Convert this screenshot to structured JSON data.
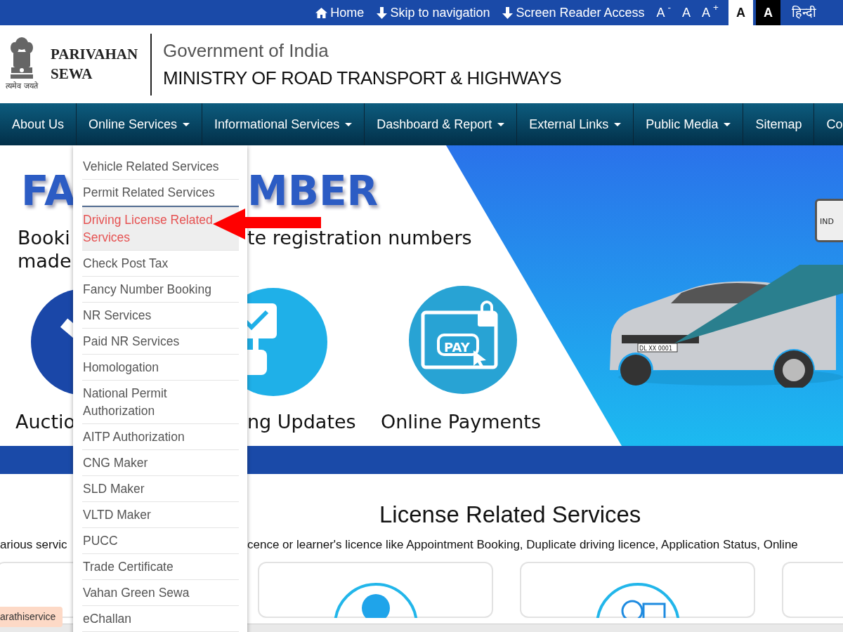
{
  "top_bar": {
    "links": [
      {
        "kind": "home",
        "label": "Home"
      },
      {
        "kind": "down",
        "label": "Skip to navigation"
      },
      {
        "kind": "down",
        "label": "Screen Reader Access"
      }
    ],
    "font_size_buttons": [
      "A$^{-}$",
      "A",
      "A$^{+}$"
    ],
    "contrast_buttons": [
      {
        "kind": "light",
        "label": "A"
      },
      {
        "kind": "dark",
        "label": "A"
      }
    ],
    "language": "हिन्दी"
  },
  "header": {
    "brand_lines": [
      "PARIVAHAN",
      "SEWA"
    ],
    "motto": "त्यमेव जयते",
    "org": "Government of India",
    "ministry": "MINISTRY OF ROAD TRANSPORT & HIGHWAYS"
  },
  "nav": [
    {
      "label": "About Us",
      "dropdown": false
    },
    {
      "label": "Online Services",
      "dropdown": true
    },
    {
      "label": "Informational Services",
      "dropdown": true
    },
    {
      "label": "Dashboard & Report",
      "dropdown": true
    },
    {
      "label": "External Links",
      "dropdown": true
    },
    {
      "label": "Public Media",
      "dropdown": true
    },
    {
      "label": "Sitemap",
      "dropdown": false
    },
    {
      "label": "Co",
      "dropdown": false
    }
  ],
  "menu": [
    {
      "label": "Vehicle Related Services",
      "selected": false
    },
    {
      "label": "Permit Related Services",
      "selected": false
    },
    {
      "label": "Driving License Related Services",
      "selected": true
    },
    {
      "label": "Check Post Tax",
      "selected": false
    },
    {
      "label": "Fancy Number Booking",
      "selected": false
    },
    {
      "label": "NR Services",
      "selected": false
    },
    {
      "label": "Paid NR Services",
      "selected": false
    },
    {
      "label": "Homologation",
      "selected": false
    },
    {
      "label": "National Permit Authorization",
      "selected": false
    },
    {
      "label": "AITP Authorization",
      "selected": false
    },
    {
      "label": "CNG Maker",
      "selected": false
    },
    {
      "label": "SLD Maker",
      "selected": false
    },
    {
      "label": "VLTD Maker",
      "selected": false
    },
    {
      "label": "PUCC",
      "selected": false
    },
    {
      "label": "Trade Certificate",
      "selected": false
    },
    {
      "label": "Vahan Green Sewa",
      "selected": false
    },
    {
      "label": "eChallan",
      "selected": false
    }
  ],
  "banner": {
    "title_parts": [
      "FA",
      "MBER"
    ],
    "subtitle_parts": [
      "Booki",
      "te registration numbers",
      "made"
    ],
    "captions": [
      "Auctio",
      "ng Updates",
      "Online Payments"
    ],
    "pay_label": "PAY",
    "plate_text": "DL XX 0001",
    "big_plate_text": "IND"
  },
  "license_section": {
    "heading": "License Related Services",
    "description_parts": [
      "arious servic",
      "cence or learner's licence like Appointment Booking, Duplicate driving licence, Application Status, Online"
    ],
    "cards": [
      {
        "kind": "plain"
      },
      {
        "kind": "person"
      },
      {
        "kind": "person-calendar"
      },
      {
        "kind": "plain"
      }
    ]
  },
  "tag": "arathiservice"
}
